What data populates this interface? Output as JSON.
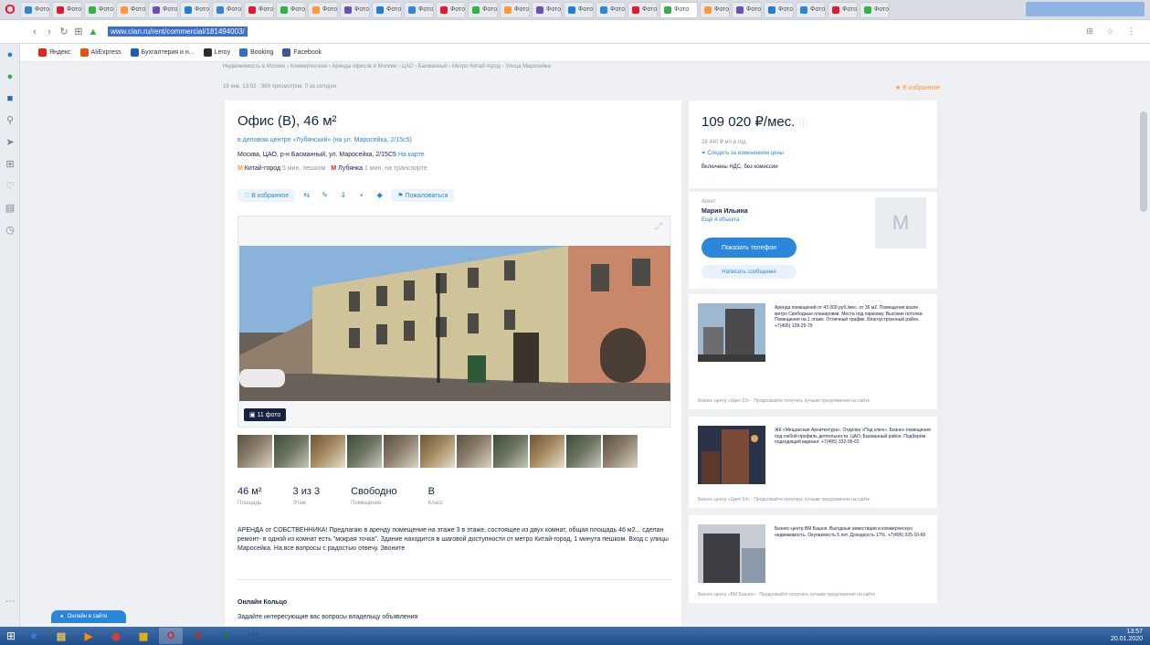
{
  "browser": {
    "tabs": [
      "Фото",
      "Фото",
      "Фото",
      "Фото",
      "Фото",
      "Фото",
      "Фото",
      "Фото",
      "Фото",
      "Фото",
      "Фото",
      "Фото",
      "Фото",
      "Фото",
      "Фото",
      "Фото",
      "Фото",
      "Фото",
      "Фото",
      "Фото",
      "Фото",
      "Фото",
      "Фото",
      "Фото",
      "Фото",
      "Фото",
      "Фото"
    ],
    "active_tab": "Фото",
    "url": "www.cian.ru/rent/commercial/181494003/",
    "toolbar_icons": "⊞ ☆ ⋮",
    "bookmarks": [
      "Яндекс",
      "AliExpress",
      "Бухгалтерия и н...",
      "Leroy",
      "Booking",
      "Facebook"
    ],
    "bookmark_colors": [
      "#e52620",
      "#e8500e",
      "#1e5bbf",
      "#2d2d2d",
      "#2e70c8",
      "#3b5998"
    ]
  },
  "sidebar_icons": [
    "messenger-icon",
    "whatsapp-icon",
    "vk-icon",
    "search-icon",
    "send-icon",
    "grid-icon",
    "heart-icon",
    "news-icon",
    "history-icon"
  ],
  "sidebar": {
    "more": "···"
  },
  "page": {
    "breadcrumbs": "Недвижимость в Москве › Коммерческая › Аренда офисов в Москве › ЦАО › Басманный › Метро Китай-город › Улица Маросейка",
    "meta": "18 янв, 13:02 · 369 просмотров, 0 за сегодня",
    "favorite": "В избранное"
  },
  "listing": {
    "title": "Офис (B), 46 м²",
    "business_center": "в деловом центре «Лубянский» (на ул. Маросейка, 2/15с5)",
    "address": "Москва, ЦАО, р-н Басманный, ул. Маросейка, 2/15С5",
    "map_link": "На карте",
    "metro1_name": "Китай-город",
    "metro1_time": "5 мин. пешком",
    "metro2_name": "Лубянка",
    "metro2_time": "1 мин. на транспорте",
    "action_fav": "В избранное",
    "action_complain": "Пожаловаться",
    "photo_count": "11 фото",
    "specs": [
      {
        "value": "46 м²",
        "label": "Площадь"
      },
      {
        "value": "3 из 3",
        "label": "Этаж"
      },
      {
        "value": "Свободно",
        "label": "Помещение"
      },
      {
        "value": "B",
        "label": "Класс"
      }
    ],
    "description": "АРЕНДА от СОБСТВЕННИКА! Предлагаю в аренду помещение на этаже 3 в этаже, состоящее из двух комнат, общая площадь 46 м2... сделан ремонт- в одной из комнат есть \"мокрая точка\". Здание находится в шаговой доступности от метро Китай-город, 1 минута пешком. Вход с улицы Маросейка. На все вопросы с радостью отвечу. Звоните",
    "owner_title": "Онлайн Кольцо",
    "owner_question": "Задайте интересующие вас вопросы владельцу объявления"
  },
  "price": {
    "value": "109 020 ₽/мес.",
    "per_m2": "28 440 ₽ м²/ в год",
    "history_link": "Следить за изменением цены",
    "vat": "Включены НДС, без комиссии"
  },
  "agent": {
    "role": "Агент",
    "name": "Мария Ильина",
    "more": "Ещё 4 объекта",
    "phone_button": "Показать телефон",
    "message_button": "Написать сообщение",
    "avatar_letter": "М"
  },
  "ads": [
    {
      "text": "Аренда помещений от 43 000 руб./мес. от 36 м2. Помещения возле метро Свободные планировки. Места под парковку. Высокие потолки. Помещения на 1 этаже. Отличный трафик. Благоустроенный район. +7(495) 128-25-79",
      "foot": "Бизнес-центр «Цвет-23» · Продолжайте получать лучшие предложения на сайте"
    },
    {
      "text": "ЖК «Мещанская Архитектура». Отделка «Под ключ». Бизнес-помещения под любой профиль деятельности. ЦАО, Басманный район. Подберём подходящий вариант. +7(495) 332-95-62",
      "foot": "Бизнес-центр «Цвет-24» · Продолжайте получать лучшие предложения на сайте"
    },
    {
      "text": "Бизнес-центр ВМ Башня. Выгодные инвестиции в коммерческую недвижимость. Окупаемость 5 лет. Доходность 17%. +7(495) 025-10-60",
      "foot": "Бизнес-центр «ВМ Башня» · Продолжайте получать лучшие предложения на сайте"
    }
  ],
  "chat_widget": "Онлайн в сайте",
  "taskbar": {
    "start": "⊞",
    "apps": [
      "e",
      "▤",
      "▶",
      "◉",
      "▦",
      "O",
      "A",
      "X",
      "W"
    ],
    "app_colors": [
      "#3a8ee6",
      "#f2c94c",
      "#ff8a00",
      "#e63a2e",
      "#f2b705",
      "#e5192b",
      "#d4281c",
      "#1f7a3a",
      "#2b579a"
    ],
    "time": "13:57",
    "date": "20.01.2020"
  }
}
